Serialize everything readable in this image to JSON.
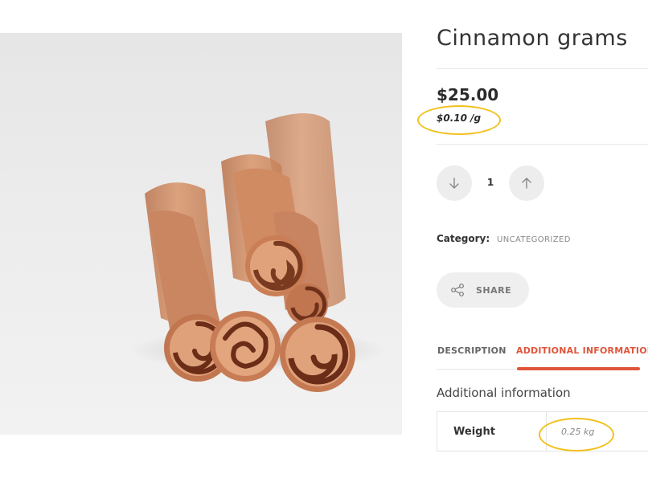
{
  "product": {
    "title": "Cinnamon grams",
    "price": "$25.00",
    "unit_price": "$0.10 /g",
    "image_subject": "cinnamon-sticks"
  },
  "quantity": {
    "value": "1",
    "decrease_icon": "arrow-down-icon",
    "increase_icon": "arrow-up-icon"
  },
  "category": {
    "label": "Category:",
    "value": "UNCATEGORIZED"
  },
  "share": {
    "label": "SHARE",
    "icon": "share-icon"
  },
  "tabs": [
    {
      "label": "DESCRIPTION",
      "active": false
    },
    {
      "label": "ADDITIONAL INFORMATION",
      "active": true
    }
  ],
  "additional_info": {
    "heading": "Additional information",
    "rows": [
      {
        "label": "Weight",
        "value": "0.25 kg"
      }
    ]
  },
  "colors": {
    "accent": "#e0553a",
    "highlight_ring": "#f2c11d",
    "button_bg": "#ededed"
  }
}
